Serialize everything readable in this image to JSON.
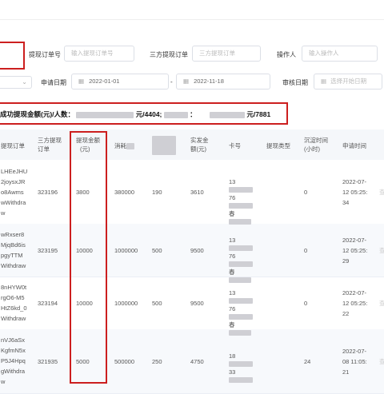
{
  "filters": {
    "order_no_label": "提现订单号",
    "order_no_placeholder": "输入提现订单号",
    "third_order_label": "三方提现订单",
    "third_order_placeholder": "三方提现订单",
    "operator_label": "操作人",
    "operator_placeholder": "输入操作人",
    "apply_date_label": "申请日期",
    "date_start": "2022-01-01",
    "date_sep": "-",
    "date_end": "2022-11-18",
    "review_date_label": "审核日期",
    "review_date_placeholder": "选择开始日期"
  },
  "summary": {
    "prefix": "成功提现金额(元)/人数：",
    "part1_suffix": "元/4404;",
    "colon": "：",
    "part2_suffix": "元/7881"
  },
  "columns": {
    "order_no": "提现订单",
    "third_order": [
      "三方提现",
      "订单"
    ],
    "amount": [
      "提现金额",
      "(元)"
    ],
    "consume": "消耗",
    "actual": [
      "实发金",
      "额(元)"
    ],
    "card": "卡号",
    "type": "提现类型",
    "settle": [
      "沉淀时间",
      "(小时)"
    ],
    "apply_time": "申请时间"
  },
  "rows": [
    {
      "order": [
        "LHEeJHU",
        "2joysxJR",
        "o8Awms",
        "wWithdra",
        "w"
      ],
      "third": "323196",
      "amount": "3800",
      "consume": "380000",
      "fee": "190",
      "actual": "3610",
      "card": [
        "13",
        "76",
        "春"
      ],
      "settle": "0",
      "time": [
        "2022-07-",
        "12 05:25:",
        "34"
      ]
    },
    {
      "order": [
        "wRxser8",
        "MjqBd6is",
        "pgyTTM",
        "Withdraw"
      ],
      "third": "323195",
      "amount": "10000",
      "consume": "1000000",
      "fee": "500",
      "actual": "9500",
      "card": [
        "13",
        "76",
        "春"
      ],
      "settle": "0",
      "time": [
        "2022-07-",
        "12 05:25:",
        "29"
      ]
    },
    {
      "order": [
        "8nHYW0t",
        "rgO6-M5",
        "HtZ6kd_0",
        "Withdraw"
      ],
      "third": "323194",
      "amount": "10000",
      "consume": "1000000",
      "fee": "500",
      "actual": "9500",
      "card": [
        "13",
        "76",
        "春"
      ],
      "settle": "0",
      "time": [
        "2022-07-",
        "12 05:25:",
        "22"
      ]
    },
    {
      "order": [
        "nVJ6aSx",
        "KgfmN5x",
        "P5J4Hpq",
        "gWithdra",
        "w"
      ],
      "third": "321935",
      "amount": "5000",
      "consume": "500000",
      "fee": "250",
      "actual": "4750",
      "card": [
        "18",
        "33",
        ""
      ],
      "settle": "24",
      "time": [
        "2022-07-",
        "08 11:05:",
        "21"
      ]
    }
  ]
}
